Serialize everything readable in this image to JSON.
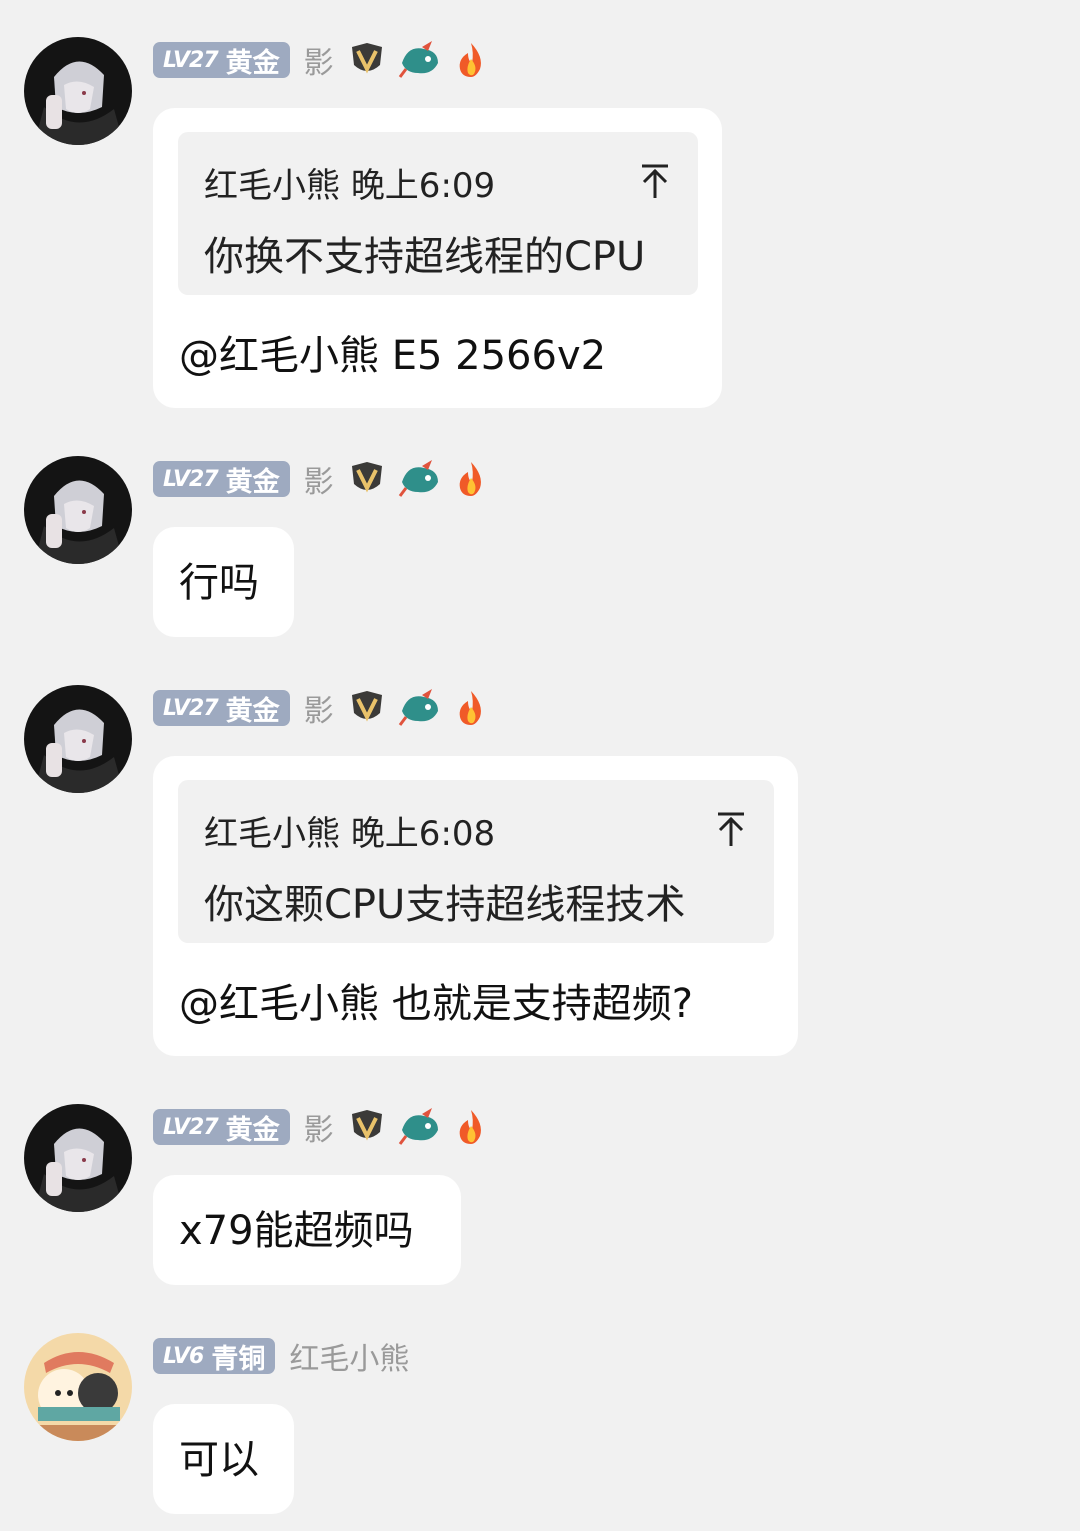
{
  "messages": [
    {
      "badge_level": "LV27",
      "badge_rank": "黄金",
      "nickname": "影",
      "quote": {
        "author": "红毛小熊",
        "time": "晚上6:09",
        "text": "你换不支持超线程的CPU"
      },
      "text": "@红毛小熊 E5 2566v2"
    },
    {
      "badge_level": "LV27",
      "badge_rank": "黄金",
      "nickname": "影",
      "text": "行吗"
    },
    {
      "badge_level": "LV27",
      "badge_rank": "黄金",
      "nickname": "影",
      "quote": {
        "author": "红毛小熊",
        "time": "晚上6:08",
        "text": "你这颗CPU支持超线程技术"
      },
      "text": "@红毛小熊 也就是支持超频?"
    },
    {
      "badge_level": "LV27",
      "badge_rank": "黄金",
      "nickname": "影",
      "text": "x79能超频吗"
    },
    {
      "badge_level": "LV6",
      "badge_rank": "青铜",
      "nickname": "红毛小熊",
      "text": "可以"
    }
  ],
  "colors": {
    "background": "#f1f1f1",
    "bubble": "#ffffff",
    "badge": "#9eaac0",
    "nickname": "#9a9a9a"
  },
  "icons": [
    "vip-shield-icon",
    "dragon-icon",
    "fire-icon",
    "jump-to-original-icon"
  ]
}
